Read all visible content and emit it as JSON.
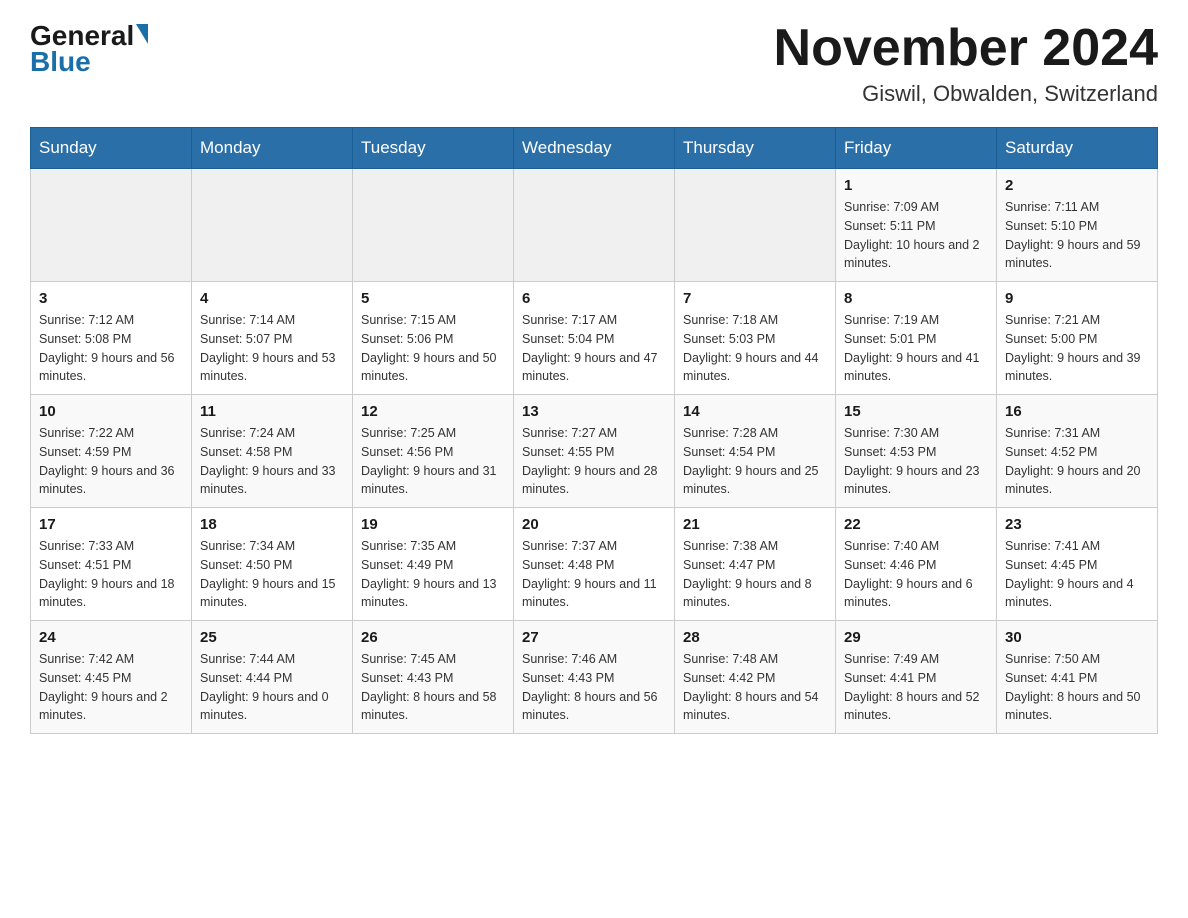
{
  "header": {
    "logo_general": "General",
    "logo_blue": "Blue",
    "title": "November 2024",
    "subtitle": "Giswil, Obwalden, Switzerland"
  },
  "calendar": {
    "days_of_week": [
      "Sunday",
      "Monday",
      "Tuesday",
      "Wednesday",
      "Thursday",
      "Friday",
      "Saturday"
    ],
    "weeks": [
      [
        {
          "day": "",
          "info": ""
        },
        {
          "day": "",
          "info": ""
        },
        {
          "day": "",
          "info": ""
        },
        {
          "day": "",
          "info": ""
        },
        {
          "day": "",
          "info": ""
        },
        {
          "day": "1",
          "info": "Sunrise: 7:09 AM\nSunset: 5:11 PM\nDaylight: 10 hours and 2 minutes."
        },
        {
          "day": "2",
          "info": "Sunrise: 7:11 AM\nSunset: 5:10 PM\nDaylight: 9 hours and 59 minutes."
        }
      ],
      [
        {
          "day": "3",
          "info": "Sunrise: 7:12 AM\nSunset: 5:08 PM\nDaylight: 9 hours and 56 minutes."
        },
        {
          "day": "4",
          "info": "Sunrise: 7:14 AM\nSunset: 5:07 PM\nDaylight: 9 hours and 53 minutes."
        },
        {
          "day": "5",
          "info": "Sunrise: 7:15 AM\nSunset: 5:06 PM\nDaylight: 9 hours and 50 minutes."
        },
        {
          "day": "6",
          "info": "Sunrise: 7:17 AM\nSunset: 5:04 PM\nDaylight: 9 hours and 47 minutes."
        },
        {
          "day": "7",
          "info": "Sunrise: 7:18 AM\nSunset: 5:03 PM\nDaylight: 9 hours and 44 minutes."
        },
        {
          "day": "8",
          "info": "Sunrise: 7:19 AM\nSunset: 5:01 PM\nDaylight: 9 hours and 41 minutes."
        },
        {
          "day": "9",
          "info": "Sunrise: 7:21 AM\nSunset: 5:00 PM\nDaylight: 9 hours and 39 minutes."
        }
      ],
      [
        {
          "day": "10",
          "info": "Sunrise: 7:22 AM\nSunset: 4:59 PM\nDaylight: 9 hours and 36 minutes."
        },
        {
          "day": "11",
          "info": "Sunrise: 7:24 AM\nSunset: 4:58 PM\nDaylight: 9 hours and 33 minutes."
        },
        {
          "day": "12",
          "info": "Sunrise: 7:25 AM\nSunset: 4:56 PM\nDaylight: 9 hours and 31 minutes."
        },
        {
          "day": "13",
          "info": "Sunrise: 7:27 AM\nSunset: 4:55 PM\nDaylight: 9 hours and 28 minutes."
        },
        {
          "day": "14",
          "info": "Sunrise: 7:28 AM\nSunset: 4:54 PM\nDaylight: 9 hours and 25 minutes."
        },
        {
          "day": "15",
          "info": "Sunrise: 7:30 AM\nSunset: 4:53 PM\nDaylight: 9 hours and 23 minutes."
        },
        {
          "day": "16",
          "info": "Sunrise: 7:31 AM\nSunset: 4:52 PM\nDaylight: 9 hours and 20 minutes."
        }
      ],
      [
        {
          "day": "17",
          "info": "Sunrise: 7:33 AM\nSunset: 4:51 PM\nDaylight: 9 hours and 18 minutes."
        },
        {
          "day": "18",
          "info": "Sunrise: 7:34 AM\nSunset: 4:50 PM\nDaylight: 9 hours and 15 minutes."
        },
        {
          "day": "19",
          "info": "Sunrise: 7:35 AM\nSunset: 4:49 PM\nDaylight: 9 hours and 13 minutes."
        },
        {
          "day": "20",
          "info": "Sunrise: 7:37 AM\nSunset: 4:48 PM\nDaylight: 9 hours and 11 minutes."
        },
        {
          "day": "21",
          "info": "Sunrise: 7:38 AM\nSunset: 4:47 PM\nDaylight: 9 hours and 8 minutes."
        },
        {
          "day": "22",
          "info": "Sunrise: 7:40 AM\nSunset: 4:46 PM\nDaylight: 9 hours and 6 minutes."
        },
        {
          "day": "23",
          "info": "Sunrise: 7:41 AM\nSunset: 4:45 PM\nDaylight: 9 hours and 4 minutes."
        }
      ],
      [
        {
          "day": "24",
          "info": "Sunrise: 7:42 AM\nSunset: 4:45 PM\nDaylight: 9 hours and 2 minutes."
        },
        {
          "day": "25",
          "info": "Sunrise: 7:44 AM\nSunset: 4:44 PM\nDaylight: 9 hours and 0 minutes."
        },
        {
          "day": "26",
          "info": "Sunrise: 7:45 AM\nSunset: 4:43 PM\nDaylight: 8 hours and 58 minutes."
        },
        {
          "day": "27",
          "info": "Sunrise: 7:46 AM\nSunset: 4:43 PM\nDaylight: 8 hours and 56 minutes."
        },
        {
          "day": "28",
          "info": "Sunrise: 7:48 AM\nSunset: 4:42 PM\nDaylight: 8 hours and 54 minutes."
        },
        {
          "day": "29",
          "info": "Sunrise: 7:49 AM\nSunset: 4:41 PM\nDaylight: 8 hours and 52 minutes."
        },
        {
          "day": "30",
          "info": "Sunrise: 7:50 AM\nSunset: 4:41 PM\nDaylight: 8 hours and 50 minutes."
        }
      ]
    ]
  }
}
